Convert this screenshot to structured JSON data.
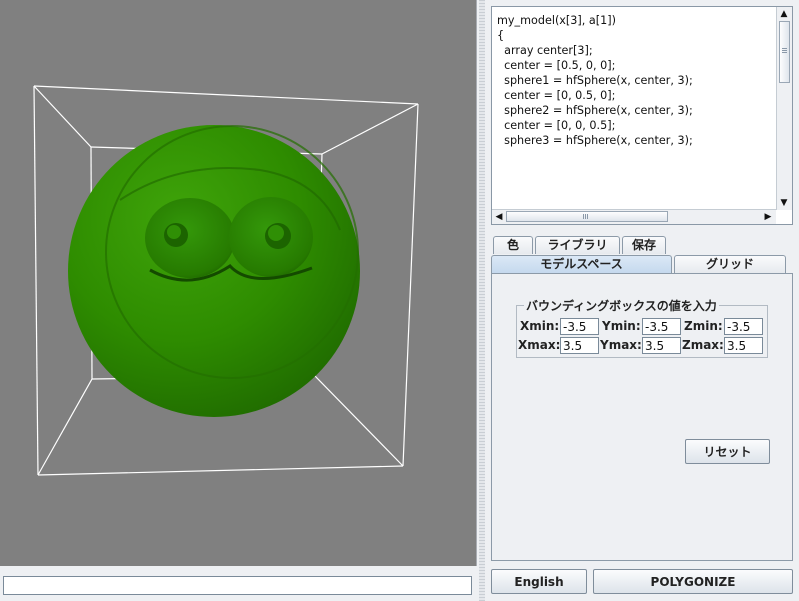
{
  "colors": {
    "viewport_bg": "#808080",
    "model_green": "#2e8c00",
    "bbox_wire": "#ffffff",
    "active_tab": "#c5d9ee"
  },
  "command_input": {
    "value": ""
  },
  "code_editor": {
    "lines": [
      "my_model(x[3], a[1])",
      "{",
      "",
      "  array center[3];",
      "",
      "  center = [0.5, 0, 0];",
      "  sphere1 = hfSphere(x, center, 3);",
      "",
      "  center = [0, 0.5, 0];",
      "  sphere2 = hfSphere(x, center, 3);",
      "",
      "  center = [0, 0, 0.5];",
      "  sphere3 = hfSphere(x, center, 3);"
    ],
    "scroll_up_icon": "triangle-up",
    "scroll_down_icon": "triangle-down",
    "scroll_left_icon": "triangle-left",
    "scroll_right_icon": "triangle-right"
  },
  "tabs_row1": [
    {
      "label": "色"
    },
    {
      "label": "ライブラリ"
    },
    {
      "label": "保存"
    }
  ],
  "tabs_row2": [
    {
      "label": "モデルスペース",
      "active": true
    },
    {
      "label": "グリッド",
      "active": false
    }
  ],
  "bbox_group": {
    "title": "バウンディングボックスの値を入力",
    "xmin_label": "Xmin:",
    "xmin_value": "-3.5",
    "ymin_label": "Ymin:",
    "ymin_value": "-3.5",
    "zmin_label": "Zmin:",
    "zmin_value": "-3.5",
    "xmax_label": "Xmax:",
    "xmax_value": "3.5",
    "ymax_label": "Ymax:",
    "ymax_value": "3.5",
    "zmax_label": "Zmax:",
    "zmax_value": "3.5"
  },
  "reset_label": "リセット",
  "language_label": "English",
  "polygonize_label": "POLYGONIZE"
}
